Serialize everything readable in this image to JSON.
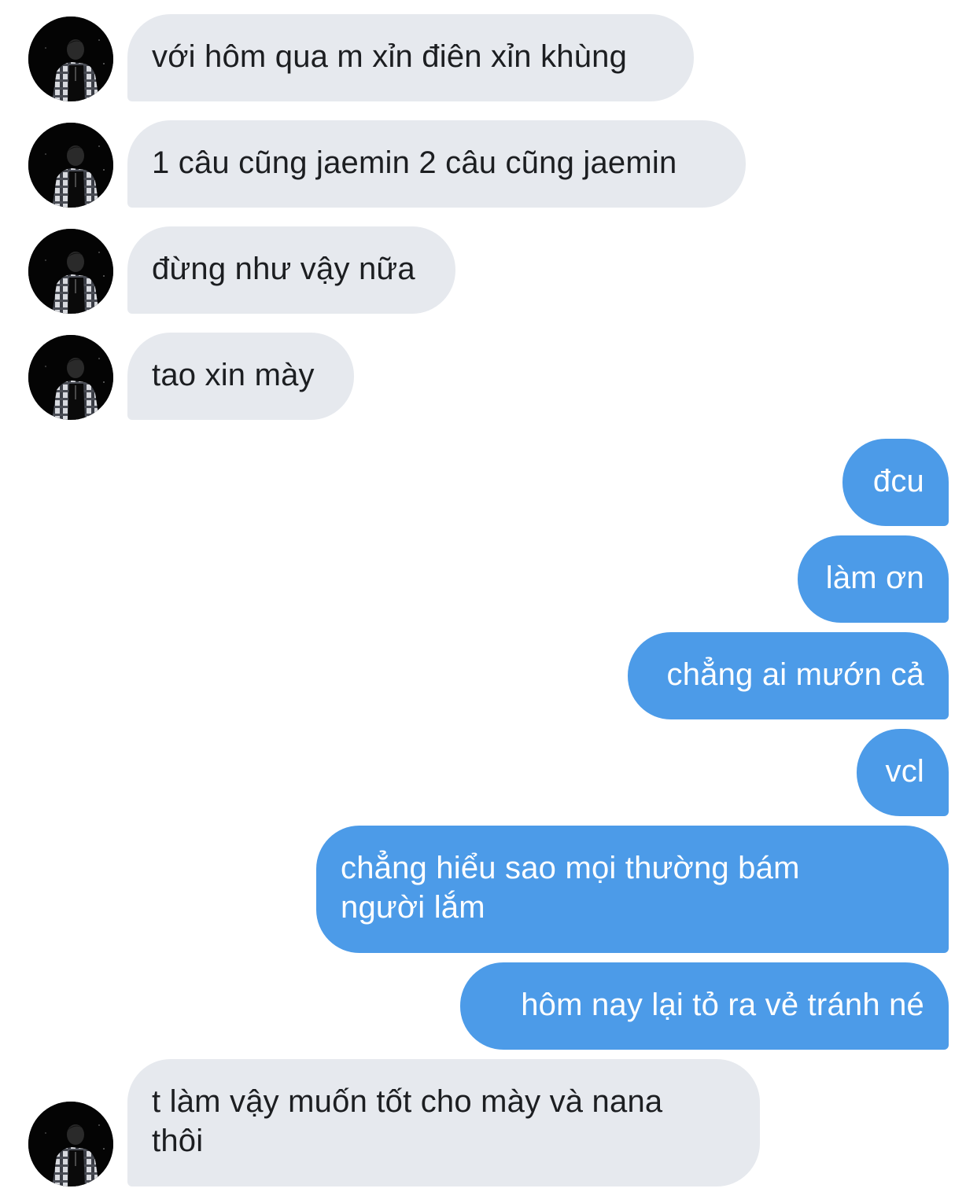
{
  "messages": [
    {
      "sender": "other",
      "text": "với hôm qua m xỉn điên xỉn khùng"
    },
    {
      "sender": "other",
      "text": "1 câu cũng jaemin 2 câu cũng jaemin"
    },
    {
      "sender": "other",
      "text": "đừng như vậy nữa"
    },
    {
      "sender": "other",
      "text": "tao xin mày"
    },
    {
      "sender": "me",
      "text": "đcu"
    },
    {
      "sender": "me",
      "text": "làm ơn"
    },
    {
      "sender": "me",
      "text": "chẳng ai mướn cả"
    },
    {
      "sender": "me",
      "text": "vcl"
    },
    {
      "sender": "me",
      "text": "chẳng hiểu sao mọi thường bám người lắm"
    },
    {
      "sender": "me",
      "text": "hôm nay lại tỏ ra vẻ tránh né"
    },
    {
      "sender": "other",
      "text": "t làm vậy muốn tốt cho mày và nana thôi"
    }
  ],
  "colors": {
    "incoming_bubble": "#e6e9ee",
    "incoming_text": "#1c1e21",
    "outgoing_bubble": "#4c9be8",
    "outgoing_text": "#ffffff"
  },
  "icons": {
    "avatar": "contact-avatar-photo"
  }
}
